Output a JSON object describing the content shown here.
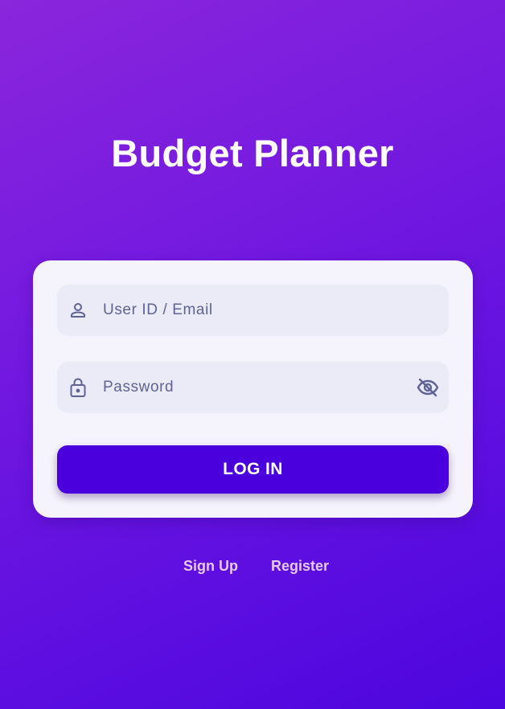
{
  "app": {
    "title": "Budget Planner"
  },
  "login_form": {
    "user_field": {
      "placeholder": "User ID / Email",
      "value": "",
      "icon": "person-icon"
    },
    "password_field": {
      "placeholder": "Password",
      "value": "",
      "icon": "lock-icon",
      "toggle_icon": "eye-off-icon"
    },
    "submit_label": "LOG IN"
  },
  "links": {
    "signup_label": "Sign Up",
    "register_label": "Register"
  },
  "colors": {
    "background_start": "#8a26dc",
    "background_end": "#4c06df",
    "card": "#f5f3fb",
    "field": "#ebebf8",
    "icon": "#5e6394",
    "button": "#4a00dc",
    "link": "#e6c9f3"
  }
}
